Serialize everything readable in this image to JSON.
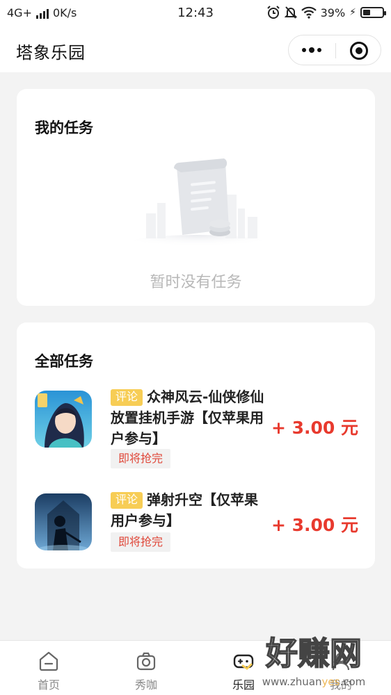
{
  "status_bar": {
    "network": "4G+",
    "speed": "0K/s",
    "time": "12:43",
    "battery_percent": "39%",
    "battery_level": 0.39
  },
  "nav": {
    "title": "塔象乐园"
  },
  "my_tasks": {
    "title": "我的任务",
    "empty_text": "暂时没有任务"
  },
  "all_tasks": {
    "title": "全部任务",
    "items": [
      {
        "tag": "评论",
        "name": "众神风云-仙侠修仙放置挂机手游【仅苹果用户参与】",
        "status": "即将抢完",
        "reward": "+ 3.00 元",
        "icon": "game-icon-goddess"
      },
      {
        "tag": "评论",
        "name": "弹射升空【仅苹果用户参与】",
        "status": "即将抢完",
        "reward": "+ 3.00 元",
        "icon": "game-icon-silhouette"
      }
    ]
  },
  "tab_bar": {
    "active": "乐园",
    "tabs": [
      {
        "label": "首页",
        "icon": "home-icon"
      },
      {
        "label": "秀咖",
        "icon": "camera-icon"
      },
      {
        "label": "乐园",
        "icon": "gamepad-icon"
      },
      {
        "label": "我的",
        "icon": "user-icon"
      }
    ]
  },
  "watermark": {
    "text_cn": "好赚网",
    "url_prefix": "www.zhuan",
    "url_highlight": "yes",
    "url_suffix": ".com"
  },
  "colors": {
    "accent_red": "#e83a2e",
    "tag_yellow": "#f7cd55",
    "background": "#f3f3f3"
  }
}
